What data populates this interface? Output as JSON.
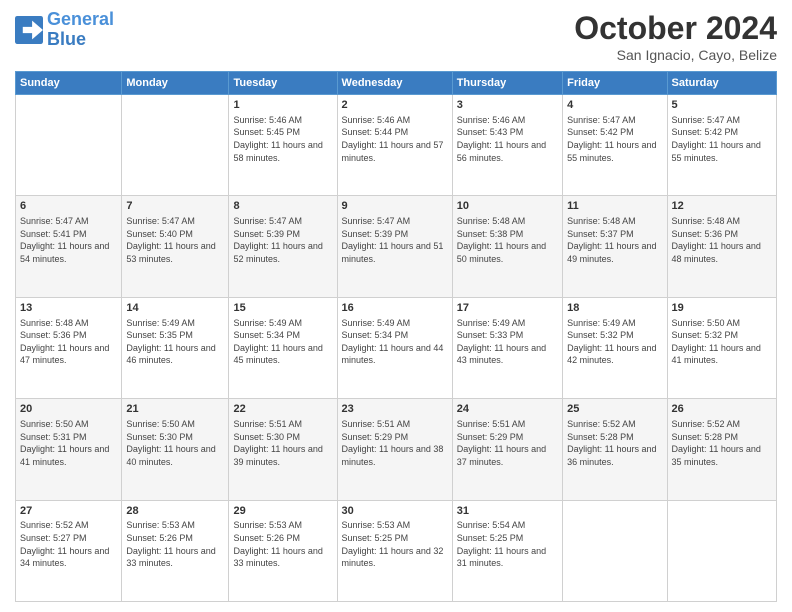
{
  "logo": {
    "line1": "General",
    "line2": "Blue"
  },
  "title": "October 2024",
  "subtitle": "San Ignacio, Cayo, Belize",
  "days_of_week": [
    "Sunday",
    "Monday",
    "Tuesday",
    "Wednesday",
    "Thursday",
    "Friday",
    "Saturday"
  ],
  "weeks": [
    [
      {
        "day": "",
        "sunrise": "",
        "sunset": "",
        "daylight": ""
      },
      {
        "day": "",
        "sunrise": "",
        "sunset": "",
        "daylight": ""
      },
      {
        "day": "1",
        "sunrise": "Sunrise: 5:46 AM",
        "sunset": "Sunset: 5:45 PM",
        "daylight": "Daylight: 11 hours and 58 minutes."
      },
      {
        "day": "2",
        "sunrise": "Sunrise: 5:46 AM",
        "sunset": "Sunset: 5:44 PM",
        "daylight": "Daylight: 11 hours and 57 minutes."
      },
      {
        "day": "3",
        "sunrise": "Sunrise: 5:46 AM",
        "sunset": "Sunset: 5:43 PM",
        "daylight": "Daylight: 11 hours and 56 minutes."
      },
      {
        "day": "4",
        "sunrise": "Sunrise: 5:47 AM",
        "sunset": "Sunset: 5:42 PM",
        "daylight": "Daylight: 11 hours and 55 minutes."
      },
      {
        "day": "5",
        "sunrise": "Sunrise: 5:47 AM",
        "sunset": "Sunset: 5:42 PM",
        "daylight": "Daylight: 11 hours and 55 minutes."
      }
    ],
    [
      {
        "day": "6",
        "sunrise": "Sunrise: 5:47 AM",
        "sunset": "Sunset: 5:41 PM",
        "daylight": "Daylight: 11 hours and 54 minutes."
      },
      {
        "day": "7",
        "sunrise": "Sunrise: 5:47 AM",
        "sunset": "Sunset: 5:40 PM",
        "daylight": "Daylight: 11 hours and 53 minutes."
      },
      {
        "day": "8",
        "sunrise": "Sunrise: 5:47 AM",
        "sunset": "Sunset: 5:39 PM",
        "daylight": "Daylight: 11 hours and 52 minutes."
      },
      {
        "day": "9",
        "sunrise": "Sunrise: 5:47 AM",
        "sunset": "Sunset: 5:39 PM",
        "daylight": "Daylight: 11 hours and 51 minutes."
      },
      {
        "day": "10",
        "sunrise": "Sunrise: 5:48 AM",
        "sunset": "Sunset: 5:38 PM",
        "daylight": "Daylight: 11 hours and 50 minutes."
      },
      {
        "day": "11",
        "sunrise": "Sunrise: 5:48 AM",
        "sunset": "Sunset: 5:37 PM",
        "daylight": "Daylight: 11 hours and 49 minutes."
      },
      {
        "day": "12",
        "sunrise": "Sunrise: 5:48 AM",
        "sunset": "Sunset: 5:36 PM",
        "daylight": "Daylight: 11 hours and 48 minutes."
      }
    ],
    [
      {
        "day": "13",
        "sunrise": "Sunrise: 5:48 AM",
        "sunset": "Sunset: 5:36 PM",
        "daylight": "Daylight: 11 hours and 47 minutes."
      },
      {
        "day": "14",
        "sunrise": "Sunrise: 5:49 AM",
        "sunset": "Sunset: 5:35 PM",
        "daylight": "Daylight: 11 hours and 46 minutes."
      },
      {
        "day": "15",
        "sunrise": "Sunrise: 5:49 AM",
        "sunset": "Sunset: 5:34 PM",
        "daylight": "Daylight: 11 hours and 45 minutes."
      },
      {
        "day": "16",
        "sunrise": "Sunrise: 5:49 AM",
        "sunset": "Sunset: 5:34 PM",
        "daylight": "Daylight: 11 hours and 44 minutes."
      },
      {
        "day": "17",
        "sunrise": "Sunrise: 5:49 AM",
        "sunset": "Sunset: 5:33 PM",
        "daylight": "Daylight: 11 hours and 43 minutes."
      },
      {
        "day": "18",
        "sunrise": "Sunrise: 5:49 AM",
        "sunset": "Sunset: 5:32 PM",
        "daylight": "Daylight: 11 hours and 42 minutes."
      },
      {
        "day": "19",
        "sunrise": "Sunrise: 5:50 AM",
        "sunset": "Sunset: 5:32 PM",
        "daylight": "Daylight: 11 hours and 41 minutes."
      }
    ],
    [
      {
        "day": "20",
        "sunrise": "Sunrise: 5:50 AM",
        "sunset": "Sunset: 5:31 PM",
        "daylight": "Daylight: 11 hours and 41 minutes."
      },
      {
        "day": "21",
        "sunrise": "Sunrise: 5:50 AM",
        "sunset": "Sunset: 5:30 PM",
        "daylight": "Daylight: 11 hours and 40 minutes."
      },
      {
        "day": "22",
        "sunrise": "Sunrise: 5:51 AM",
        "sunset": "Sunset: 5:30 PM",
        "daylight": "Daylight: 11 hours and 39 minutes."
      },
      {
        "day": "23",
        "sunrise": "Sunrise: 5:51 AM",
        "sunset": "Sunset: 5:29 PM",
        "daylight": "Daylight: 11 hours and 38 minutes."
      },
      {
        "day": "24",
        "sunrise": "Sunrise: 5:51 AM",
        "sunset": "Sunset: 5:29 PM",
        "daylight": "Daylight: 11 hours and 37 minutes."
      },
      {
        "day": "25",
        "sunrise": "Sunrise: 5:52 AM",
        "sunset": "Sunset: 5:28 PM",
        "daylight": "Daylight: 11 hours and 36 minutes."
      },
      {
        "day": "26",
        "sunrise": "Sunrise: 5:52 AM",
        "sunset": "Sunset: 5:28 PM",
        "daylight": "Daylight: 11 hours and 35 minutes."
      }
    ],
    [
      {
        "day": "27",
        "sunrise": "Sunrise: 5:52 AM",
        "sunset": "Sunset: 5:27 PM",
        "daylight": "Daylight: 11 hours and 34 minutes."
      },
      {
        "day": "28",
        "sunrise": "Sunrise: 5:53 AM",
        "sunset": "Sunset: 5:26 PM",
        "daylight": "Daylight: 11 hours and 33 minutes."
      },
      {
        "day": "29",
        "sunrise": "Sunrise: 5:53 AM",
        "sunset": "Sunset: 5:26 PM",
        "daylight": "Daylight: 11 hours and 33 minutes."
      },
      {
        "day": "30",
        "sunrise": "Sunrise: 5:53 AM",
        "sunset": "Sunset: 5:25 PM",
        "daylight": "Daylight: 11 hours and 32 minutes."
      },
      {
        "day": "31",
        "sunrise": "Sunrise: 5:54 AM",
        "sunset": "Sunset: 5:25 PM",
        "daylight": "Daylight: 11 hours and 31 minutes."
      },
      {
        "day": "",
        "sunrise": "",
        "sunset": "",
        "daylight": ""
      },
      {
        "day": "",
        "sunrise": "",
        "sunset": "",
        "daylight": ""
      }
    ]
  ]
}
